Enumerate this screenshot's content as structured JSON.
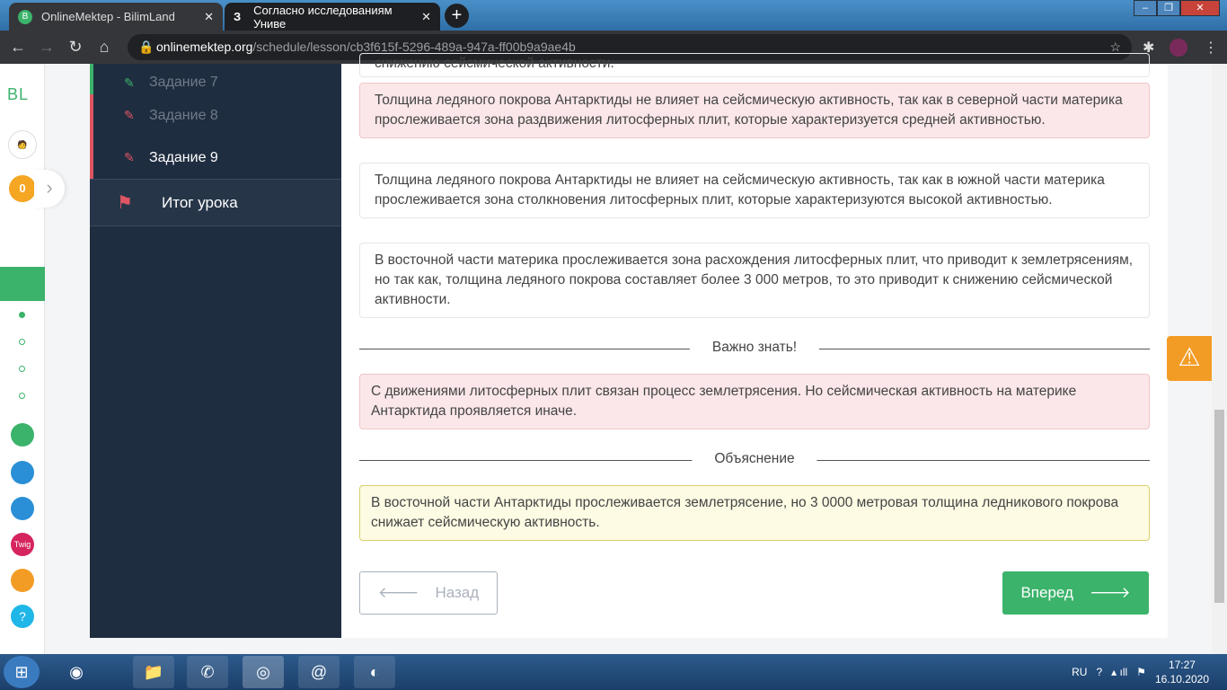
{
  "browser": {
    "tabs": [
      {
        "label": "OnlineMektep - BilimLand",
        "favicon": "B"
      },
      {
        "label": "Согласно исследованиям Униве",
        "favicon": "З"
      }
    ],
    "url_host": "onlinemektep.org",
    "url_path": "/schedule/lesson/cb3f615f-5296-489a-947a-ff00b9a9ae4b"
  },
  "leftbar": {
    "logo": "BL",
    "score": "0",
    "help": "?"
  },
  "sidebar": {
    "items": [
      {
        "label": "Задание 7"
      },
      {
        "label": "Задание 8"
      },
      {
        "label": "Задание 9"
      }
    ],
    "summary": "Итог урока"
  },
  "options": [
    "снижению сейсмической активности.",
    "Толщина ледяного покрова Антарктиды не влияет на сейсмическую активность, так как в северной части материка прослеживается зона раздвижения литосферных плит, которые характеризуется средней активностью.",
    "Толщина ледяного покрова Антарктиды не влияет на сейсмическую активность, так как в южной части материка прослеживается зона столкновения литосферных плит, которые характеризуются высокой активностью.",
    "В восточной части материка прослеживается зона расхождения литосферных плит, что приводит к землетрясениям, но так как, толщина ледяного покрова составляет более 3 000 метров, то это приводит к снижению сейсмической активности."
  ],
  "important": {
    "title": "Важно знать!",
    "text": "С движениями литосферных плит связан процесс землетрясения. Но сейсмическая активность на материке Антарктида проявляется иначе."
  },
  "explanation": {
    "title": "Объяснение",
    "text": "В восточной части Антарктиды прослеживается землетрясение, но 3 0000 метровая толщина ледникового покрова снижает сейсмическую активность."
  },
  "buttons": {
    "back": "Назад",
    "next": "Вперед"
  },
  "taskbar": {
    "lang": "RU",
    "time": "17:27",
    "date": "16.10.2020"
  }
}
